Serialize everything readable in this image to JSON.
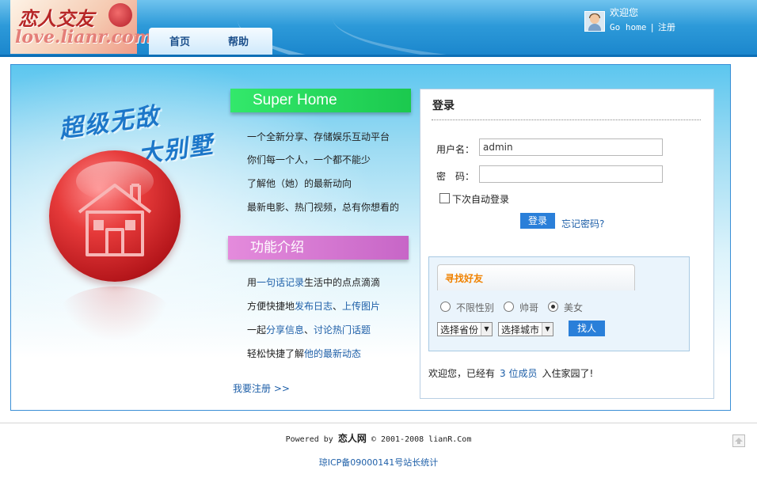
{
  "header": {
    "logo_text": "恋人交友",
    "logo_sub": "love.lianr.com",
    "nav": [
      "首页",
      "帮助"
    ],
    "welcome": "欢迎您",
    "links": [
      "Go home",
      "注册"
    ],
    "link_separator": "|"
  },
  "hero": {
    "slogan_line1": "超级无敌",
    "slogan_line2": "大别墅"
  },
  "features": {
    "banner_super": "Super Home",
    "super_lines": [
      "一个全新分享、存储娱乐互动平台",
      "你们每一个人，一个都不能少",
      "了解他（她）的最新动向",
      "最新电影、热门视频，总有你想看的"
    ],
    "banner_func": "功能介绍",
    "func_lines": [
      {
        "pre": "用",
        "hl1": "一句话记录",
        "mid": "生活中的点点滴滴",
        "sep": "",
        "hl2": "",
        "post": ""
      },
      {
        "pre": "方便快捷地",
        "hl1": "发布日志",
        "mid": "",
        "sep": "、",
        "hl2": "上传图片",
        "post": ""
      },
      {
        "pre": "一起",
        "hl1": "分享信息",
        "mid": "",
        "sep": "、",
        "hl2": "讨论热门话题",
        "post": ""
      },
      {
        "pre": "轻松快捷了解",
        "hl1": "他的最新动态",
        "mid": "",
        "sep": "",
        "hl2": "",
        "post": ""
      }
    ],
    "register_link": "我要注册 >>"
  },
  "login": {
    "title": "登录",
    "username_label": "用户名：",
    "username_value": "admin",
    "password_label": "密　码：",
    "password_value": "",
    "remember_label": "下次自动登录",
    "login_button": "登录",
    "forgot_link": "忘记密码?"
  },
  "find_friend": {
    "tab_label": "寻找好友",
    "gender_options": [
      "不限性别",
      "帅哥",
      "美女"
    ],
    "selected_gender": "美女",
    "province_select": "选择省份",
    "city_select": "选择城市",
    "find_button": "找人"
  },
  "members": {
    "pre": "欢迎您，已经有",
    "count": "3 位成员",
    "post": "入住家园了!"
  },
  "footer": {
    "powered_pre": "Powered by",
    "powered_brand": "恋人网",
    "powered_post": "© 2001-2008 lianR.Com",
    "icp": "琼ICP备09000141号站长统计"
  },
  "colors": {
    "header_blue": "#2d9ad9",
    "link_blue": "#1e5fa8",
    "button_blue": "#2a7fd9",
    "green_banner": "#1bc94e",
    "pink_banner": "#c766c7",
    "orange_tab": "#f08200",
    "orb_red": "#b5161b"
  },
  "icons": [
    "avatar-icon",
    "house-icon",
    "radio-icon",
    "dropdown-caret-icon",
    "back-to-top-icon"
  ]
}
